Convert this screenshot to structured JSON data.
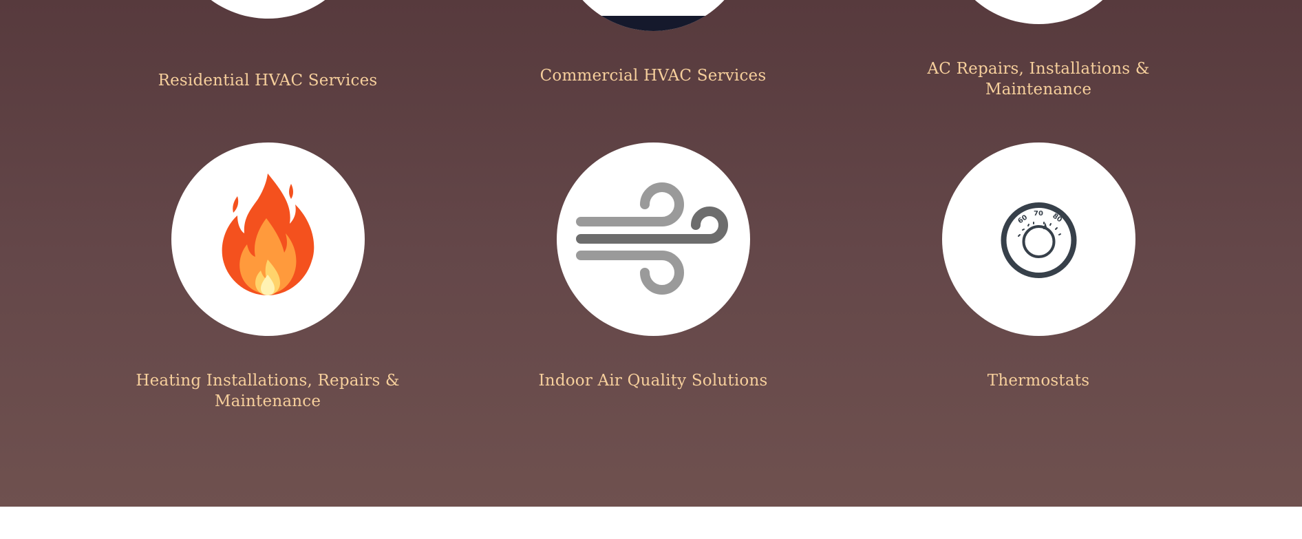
{
  "services": {
    "residential": {
      "label": "Residential HVAC Services",
      "icon": "house-icon"
    },
    "commercial": {
      "label": "Commercial HVAC Services",
      "icon": "building-icon"
    },
    "ac": {
      "label": "AC Repairs, Installations & Maintenance",
      "icon": "ac-unit-icon"
    },
    "heating": {
      "label": "Heating Installations, Repairs & Maintenance",
      "icon": "flame-icon"
    },
    "air_quality": {
      "label": "Indoor Air Quality Solutions",
      "icon": "wind-icon"
    },
    "thermostats": {
      "label": "Thermostats",
      "icon": "thermostat-icon",
      "dial_marks": [
        "60",
        "70",
        "80"
      ]
    }
  },
  "colors": {
    "section_top": "#573a3d",
    "section_bottom": "#6f514f",
    "label_text": "#f6cf9c",
    "circle": "#ffffff"
  }
}
